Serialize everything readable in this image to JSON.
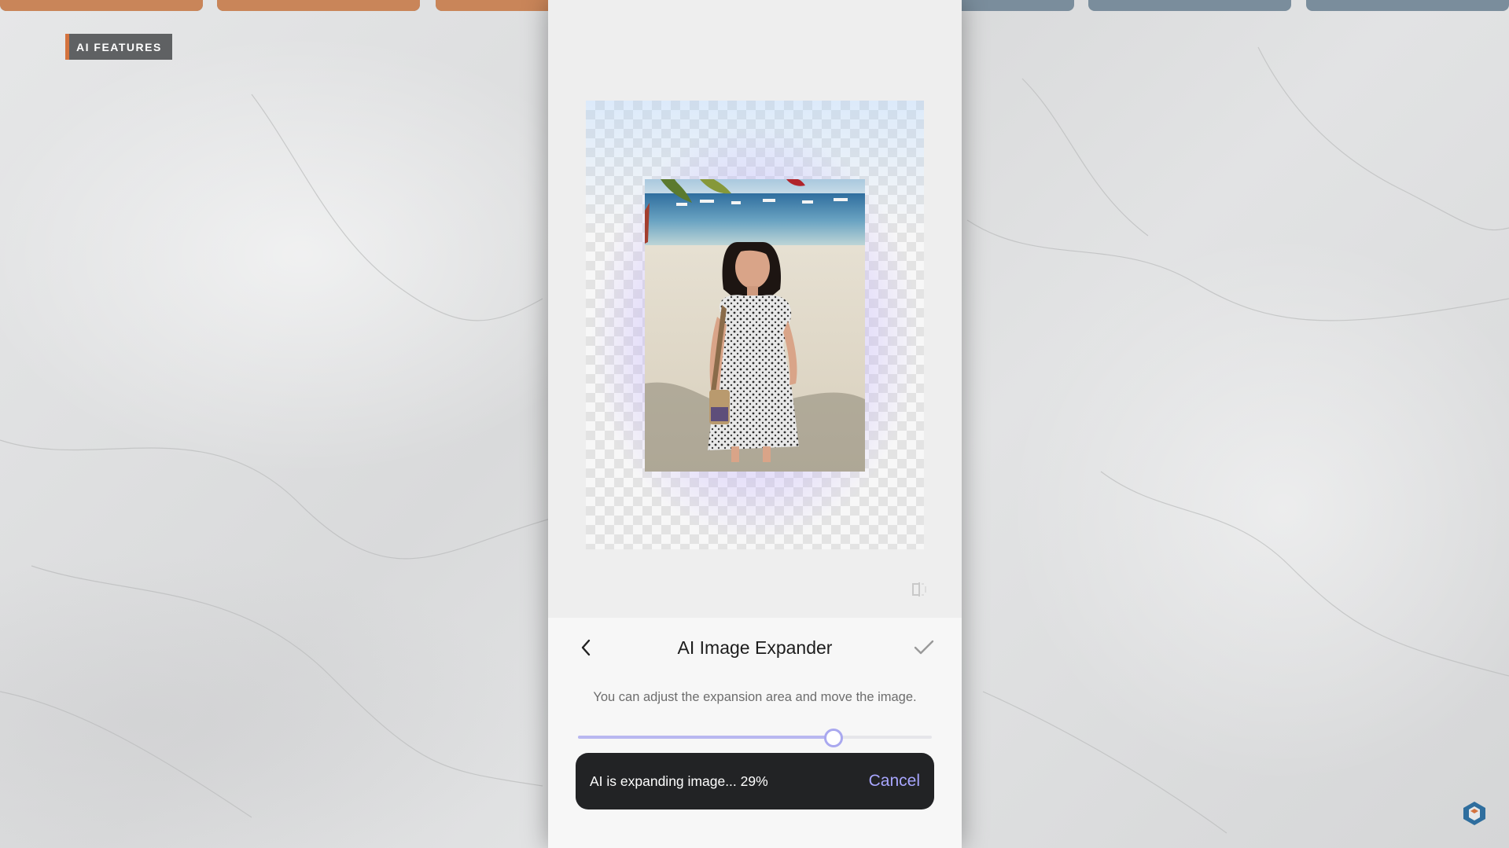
{
  "overlay": {
    "tag_label": "AI FEATURES",
    "progress_segments": [
      {
        "fill": 1.0
      },
      {
        "fill": 1.0
      },
      {
        "fill": 1.0
      },
      {
        "fill": 0.8
      },
      {
        "fill": 0.0
      },
      {
        "fill": 0.0
      },
      {
        "fill": 0.0
      }
    ],
    "accent_color": "#c98559"
  },
  "editor": {
    "title": "AI Image Expander",
    "hint": "You can adjust the expansion area and move the image.",
    "slider_value": 0.72,
    "back_icon": "chevron-left-icon",
    "confirm_icon": "check-icon",
    "compare_icon": "compare-icon"
  },
  "toast": {
    "message": "AI is expanding image... 29%",
    "cancel_label": "Cancel"
  },
  "colors": {
    "accent": "#a8a6ff",
    "toast_bg": "#222325"
  }
}
